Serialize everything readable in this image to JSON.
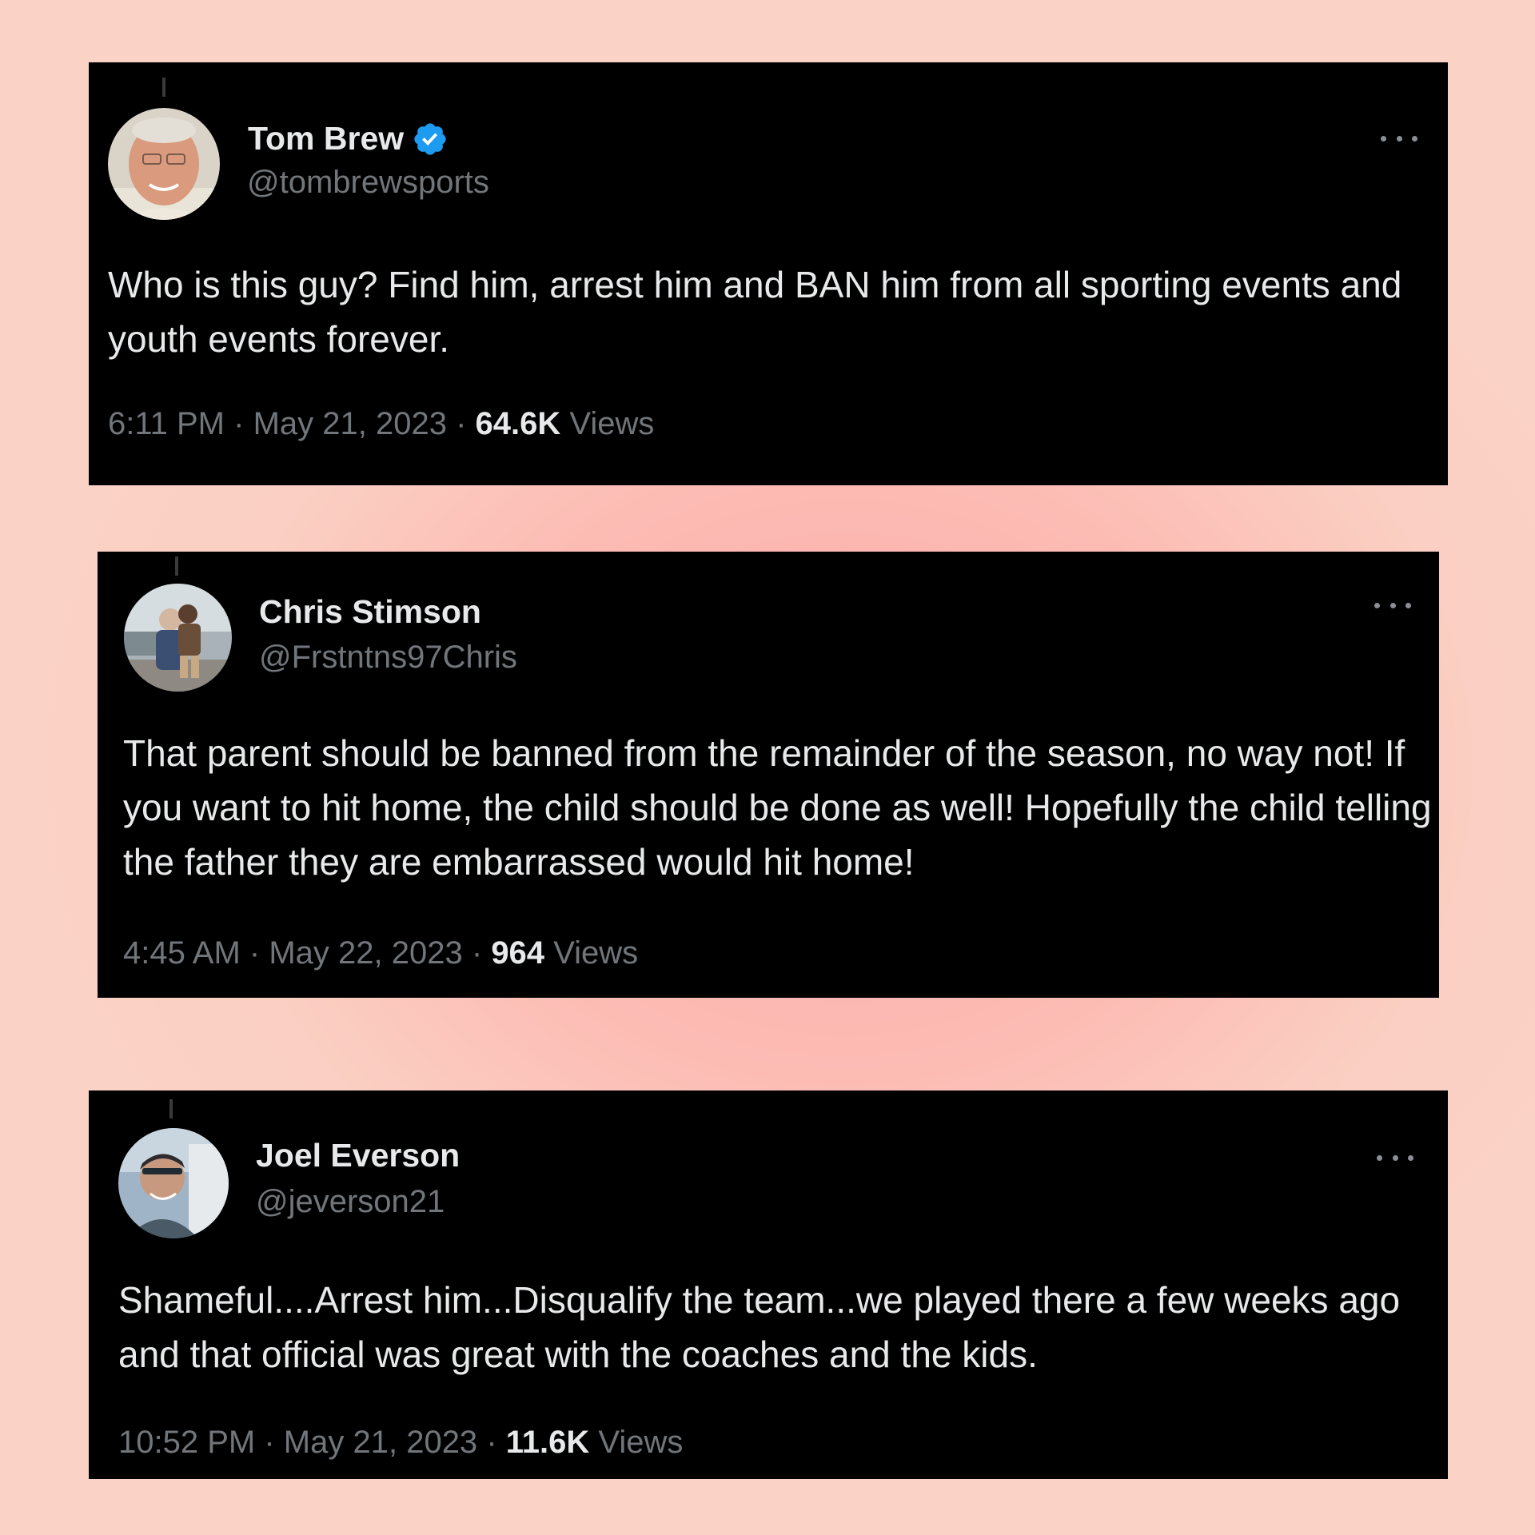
{
  "tweets": [
    {
      "name": "Tom Brew",
      "verified": true,
      "handle": "@tombrewsports",
      "text": "Who is this guy? Find him, arrest him and BAN him from all sporting events and youth events forever.",
      "time": "6:11 PM",
      "date": "May 21, 2023",
      "views_count": "64.6K",
      "views_label": "Views",
      "separator": "·"
    },
    {
      "name": "Chris Stimson",
      "verified": false,
      "handle": "@Frstntns97Chris",
      "text": "That parent should be banned from the remainder of the season, no way not! If you want to hit home, the child should be done as well! Hopefully the child telling the father they are embarrassed would hit home!",
      "time": "4:45 AM",
      "date": "May 22, 2023",
      "views_count": "964",
      "views_label": "Views",
      "separator": "·"
    },
    {
      "name": "Joel Everson",
      "verified": false,
      "handle": "@jeverson21",
      "text": "Shameful....Arrest him...Disqualify the team...we played there a few weeks ago and that official was great with the coaches and the kids.",
      "time": "10:52 PM",
      "date": "May 21, 2023",
      "views_count": "11.6K",
      "views_label": "Views",
      "separator": "·"
    }
  ],
  "colors": {
    "card_bg": "#000000",
    "text_primary": "#e7e9ea",
    "text_secondary": "#71767b",
    "verified_blue": "#1d9bf0",
    "page_bg": "#fbcfc3"
  },
  "icons": {
    "verified": "verified-badge-icon",
    "more": "more-options-icon"
  }
}
